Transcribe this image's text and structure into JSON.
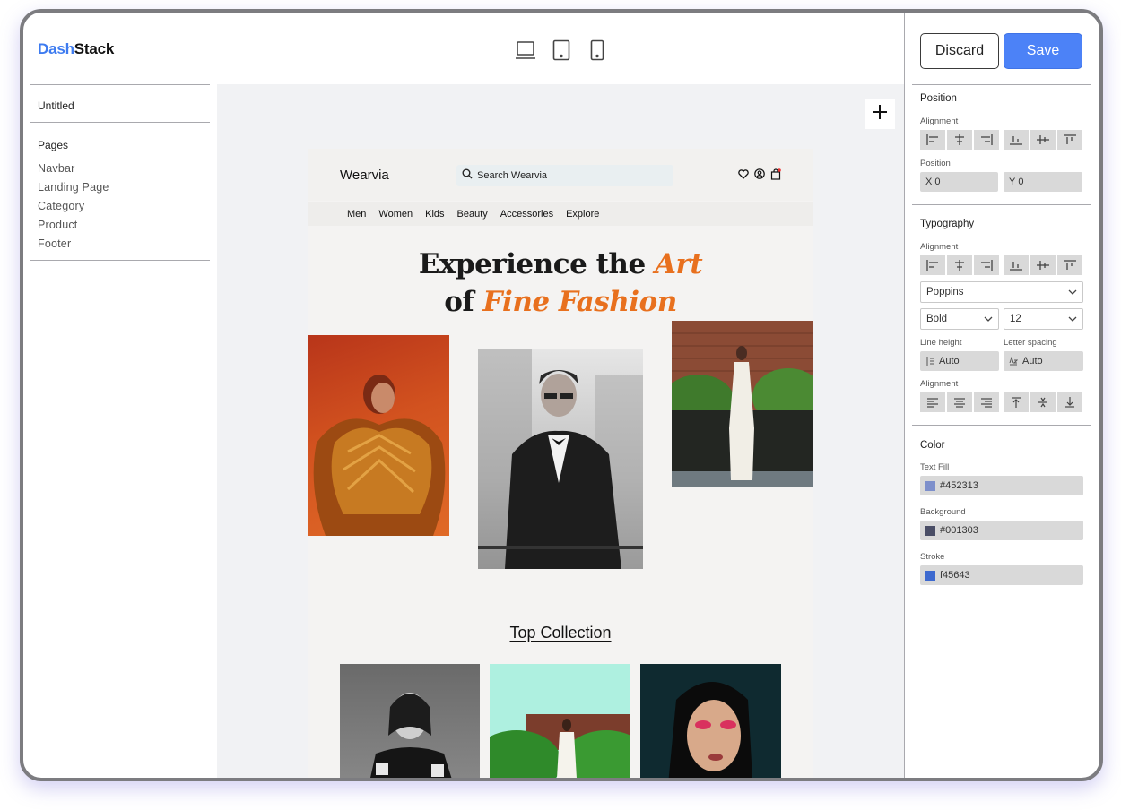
{
  "brand": {
    "part1": "Dash",
    "part2": "Stack"
  },
  "devices": [
    "laptop-icon",
    "tablet-icon",
    "mobile-icon"
  ],
  "sidebar": {
    "document_name": "Untitled",
    "pages_title": "Pages",
    "pages": [
      "Navbar",
      "Landing Page",
      "Category",
      "Product",
      "Footer"
    ]
  },
  "canvas": {
    "add_icon": "plus-icon",
    "site": {
      "logo": "Wearvia",
      "search_placeholder": "Search Wearvia",
      "nav_icons": [
        "heart-icon",
        "user-icon",
        "cart-icon"
      ],
      "categories": [
        "Men",
        "Women",
        "Kids",
        "Beauty",
        "Accessories",
        "Explore"
      ],
      "hero_line1_plain": "Experience the ",
      "hero_line1_accent": "Art",
      "hero_line2_plain": "of ",
      "hero_line2_accent": "Fine Fashion",
      "accent_color": "#e8701e",
      "top_collection": "Top Collection"
    }
  },
  "toolbar": {
    "discard_label": "Discard",
    "save_label": "Save",
    "save_color": "#4c82f7"
  },
  "properties": {
    "position": {
      "title": "Position",
      "alignment_label": "Alignment",
      "position_label": "Position",
      "x_label": "X",
      "x_value": "0",
      "y_label": "Y",
      "y_value": "0"
    },
    "typography": {
      "title": "Typography",
      "alignment_label": "Alignment",
      "font": "Poppins",
      "weight": "Bold",
      "size": "12",
      "line_height_label": "Line height",
      "line_height_value": "Auto",
      "letter_spacing_label": "Letter spacing",
      "letter_spacing_value": "Auto",
      "text_alignment_label": "Alignment"
    },
    "color": {
      "title": "Color",
      "text_fill_label": "Text Fill",
      "text_fill_value": "#452313",
      "text_fill_swatch": "#7d8fcb",
      "background_label": "Background",
      "background_value": "#001303",
      "background_swatch": "#4a4e66",
      "stroke_label": "Stroke",
      "stroke_value": "f45643",
      "stroke_swatch": "#3d69cf"
    }
  }
}
